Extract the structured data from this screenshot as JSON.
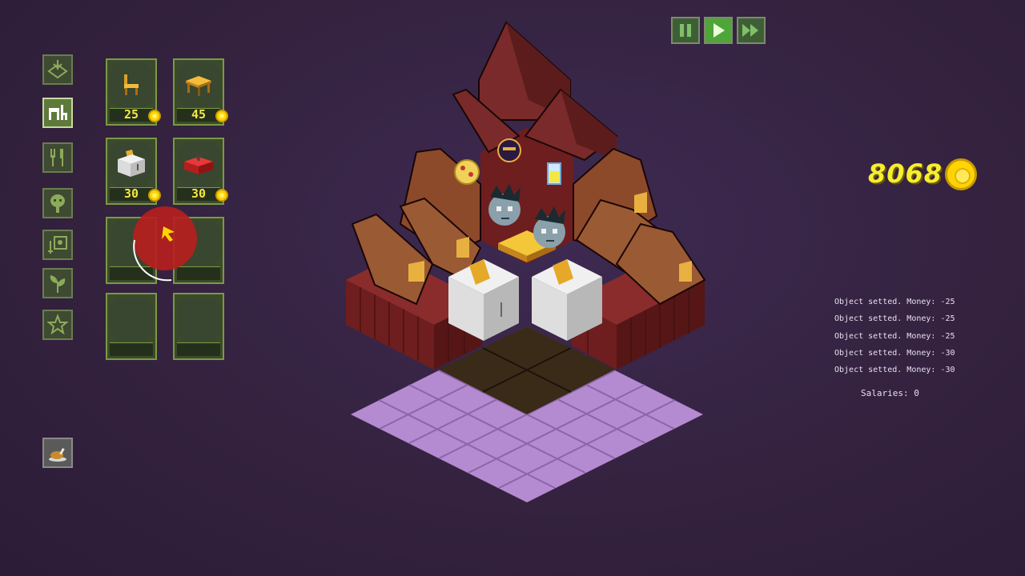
{
  "speed_controls": {
    "pause_icon": "pause-icon",
    "play_icon": "play-icon",
    "fast_forward_icon": "fast-forward-icon"
  },
  "sidebar": {
    "tabs": [
      {
        "icon": "floor-tile-icon",
        "active": false
      },
      {
        "icon": "furniture-icon",
        "active": true
      },
      {
        "icon": "cutlery-icon",
        "active": false
      },
      {
        "icon": "staff-face-icon",
        "active": false
      },
      {
        "icon": "kitchen-equipment-icon",
        "active": false
      },
      {
        "icon": "plant-icon",
        "active": false
      },
      {
        "icon": "star-icon",
        "active": false
      }
    ],
    "bottom_tab": {
      "icon": "roast-chicken-icon"
    }
  },
  "items": [
    {
      "name": "chair",
      "price": "25"
    },
    {
      "name": "table",
      "price": "45"
    },
    {
      "name": "toaster",
      "price": "30"
    },
    {
      "name": "grill",
      "price": "30"
    },
    {
      "name": "",
      "price": ""
    },
    {
      "name": "",
      "price": ""
    },
    {
      "name": "",
      "price": ""
    },
    {
      "name": "",
      "price": ""
    }
  ],
  "money": {
    "value": "8068",
    "icon": "coin-icon"
  },
  "log": [
    "Object setted. Money: -25",
    "Object setted. Money: -25",
    "Object setted. Money: -25",
    "Object setted. Money: -30",
    "Object setted. Money: -30"
  ],
  "salaries": "Salaries: 0",
  "colors": {
    "background": "#34223f",
    "panel_green": "#3c4a2c",
    "panel_border": "#7a9a44",
    "price_yellow": "#f4e840",
    "money_yellow": "#f6ee2e",
    "roof": "#7a2a2a",
    "floor_lilac": "#b48ad0"
  }
}
